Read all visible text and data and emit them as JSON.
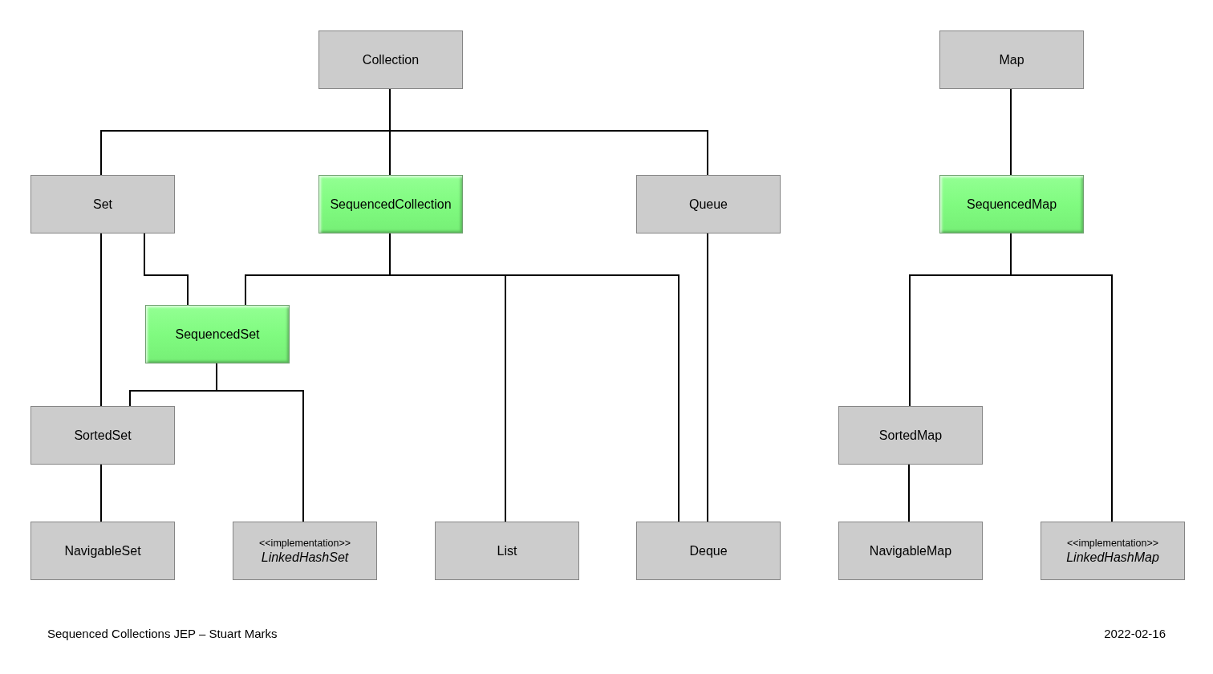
{
  "diagram": {
    "nodes": [
      {
        "kind": "interface",
        "label": "Collection",
        "highlighted": false
      },
      {
        "kind": "interface",
        "label": "Map",
        "highlighted": false
      },
      {
        "kind": "interface",
        "label": "Set",
        "highlighted": false
      },
      {
        "kind": "interface",
        "label": "SequencedCollection",
        "highlighted": true
      },
      {
        "kind": "interface",
        "label": "Queue",
        "highlighted": false
      },
      {
        "kind": "interface",
        "label": "SequencedMap",
        "highlighted": true
      },
      {
        "kind": "interface",
        "label": "SequencedSet",
        "highlighted": true
      },
      {
        "kind": "interface",
        "label": "SortedSet",
        "highlighted": false
      },
      {
        "kind": "interface",
        "label": "SortedMap",
        "highlighted": false
      },
      {
        "kind": "interface",
        "label": "NavigableSet",
        "highlighted": false
      },
      {
        "kind": "implementation",
        "stereotype": "<<implementation>>",
        "label": "LinkedHashSet",
        "highlighted": false
      },
      {
        "kind": "interface",
        "label": "List",
        "highlighted": false
      },
      {
        "kind": "interface",
        "label": "Deque",
        "highlighted": false
      },
      {
        "kind": "interface",
        "label": "NavigableMap",
        "highlighted": false
      },
      {
        "kind": "implementation",
        "stereotype": "<<implementation>>",
        "label": "LinkedHashMap",
        "highlighted": false
      }
    ]
  },
  "footer": {
    "caption": "Sequenced Collections JEP – Stuart Marks",
    "date": "2022-02-16"
  }
}
